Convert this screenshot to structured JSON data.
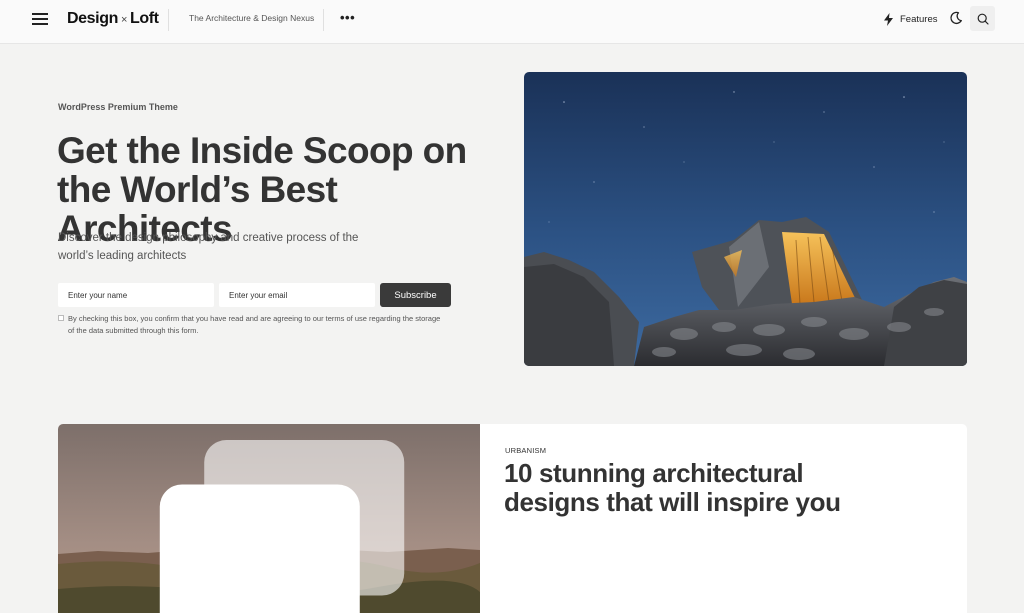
{
  "header": {
    "logo": {
      "left": "Design",
      "mid": "×",
      "right": "Loft"
    },
    "tagline": "The Architecture & Design Nexus",
    "more_label": "•••",
    "features_label": "Features",
    "icons": {
      "menu": "hamburger-icon",
      "features": "lightning-icon",
      "theme": "moon-icon",
      "search": "search-icon",
      "more": "more-dots-icon"
    }
  },
  "hero": {
    "eyebrow": "WordPress Premium Theme",
    "title": "Get the Inside Scoop on the World’s Best Architects",
    "subtitle": "Discover the design philosophy and creative process of the world’s leading architects",
    "form": {
      "name_placeholder": "Enter your name",
      "email_placeholder": "Enter your email",
      "name_value": "",
      "email_value": "",
      "subscribe_label": "Subscribe",
      "consent_text": "By checking this box, you confirm that you have read and are agreeing to our terms of use regarding the storage of the data submitted through this form."
    }
  },
  "article": {
    "category": "URBANISM",
    "title": "10 stunning architectural designs that will inspire you",
    "icons": {
      "gallery": "gallery-icon"
    }
  },
  "colors": {
    "background": "#f3f3f2",
    "header_bg": "#fafafa",
    "button_dark": "#3a3a3a",
    "text_dark": "#333333"
  }
}
